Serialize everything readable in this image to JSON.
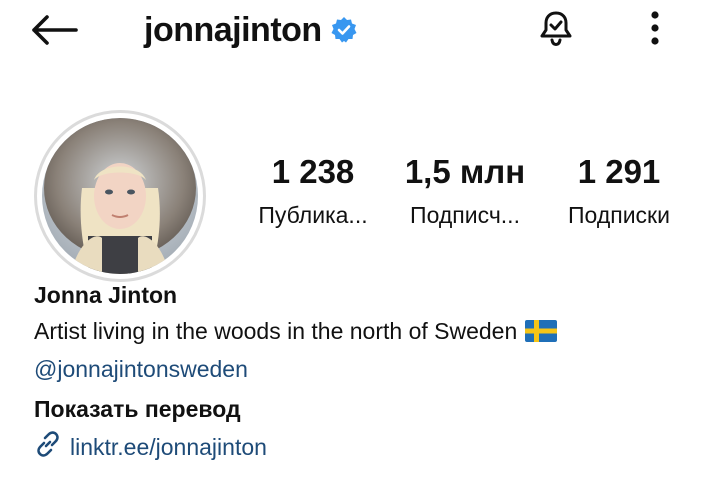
{
  "header": {
    "username": "jonnajinton",
    "back_icon": "arrow-left-icon",
    "verified_icon": "verified-badge-icon",
    "notification_icon": "bell-check-icon",
    "more_icon": "more-vertical-icon"
  },
  "profile": {
    "avatar_icon": "profile-avatar",
    "stats": [
      {
        "value": "1 238",
        "label": "Публика..."
      },
      {
        "value": "1,5 млн",
        "label": "Подписч..."
      },
      {
        "value": "1 291",
        "label": "Подписки"
      }
    ],
    "full_name": "Jonna Jinton",
    "bio": "Artist living in the woods in the north of Sweden",
    "flag_icon": "sweden-flag-icon",
    "mention": "@jonnajintonsweden",
    "translate_label": "Показать перевод",
    "link_icon": "link-icon",
    "link": "linktr.ee/jonnajinton"
  },
  "colors": {
    "text": "#111111",
    "link": "#1e4b78",
    "verified": "#3897f0",
    "avatar_ring": "#dbdbdb"
  }
}
